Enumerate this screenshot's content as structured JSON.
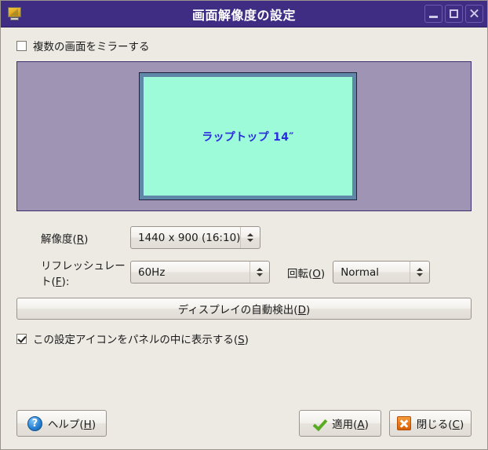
{
  "window": {
    "title": "画面解像度の設定",
    "icon": "display-monitor-icon",
    "controls": {
      "minimize": "_",
      "maximize": "□",
      "close": "✕"
    }
  },
  "mirror": {
    "label": "複数の画面をミラーする",
    "checked": false
  },
  "preview": {
    "monitor_label": "ラップトップ 14″",
    "background_color": "#a094b4",
    "screen_color": "#9efbd9",
    "screen_border_color": "#5f87a8",
    "label_color": "#2b2be0"
  },
  "form": {
    "resolution": {
      "label_prefix": "解像度(",
      "mnemonic": "R",
      "label_suffix": ")",
      "value": "1440 x 900 (16:10)"
    },
    "refresh_rate": {
      "label_prefix": "リフレッシュレート(",
      "mnemonic": "F",
      "label_suffix": "):",
      "value": "60Hz"
    },
    "rotation": {
      "label_prefix": "回転(",
      "mnemonic": "O",
      "label_suffix": ")",
      "value": "Normal"
    }
  },
  "detect_button": {
    "label_prefix": "ディスプレイの自動検出(",
    "mnemonic": "D",
    "label_suffix": ")"
  },
  "panel_icon": {
    "label_prefix": "この設定アイコンをパネルの中に表示する(",
    "mnemonic": "S",
    "label_suffix": ")",
    "checked": true
  },
  "footer": {
    "help": {
      "label_prefix": "ヘルプ(",
      "mnemonic": "H",
      "label_suffix": ")",
      "icon": "help-question-icon"
    },
    "apply": {
      "label_prefix": "適用(",
      "mnemonic": "A",
      "label_suffix": ")",
      "icon": "green-check-icon"
    },
    "close": {
      "label_prefix": "閉じる(",
      "mnemonic": "C",
      "label_suffix": ")",
      "icon": "orange-x-icon"
    }
  },
  "colors": {
    "titlebar": "#3f2d84",
    "dialog_background": "#edeae4",
    "accent_orange": "#ec7a18",
    "accent_green": "#5aab24",
    "accent_blue": "#2a84d8"
  }
}
